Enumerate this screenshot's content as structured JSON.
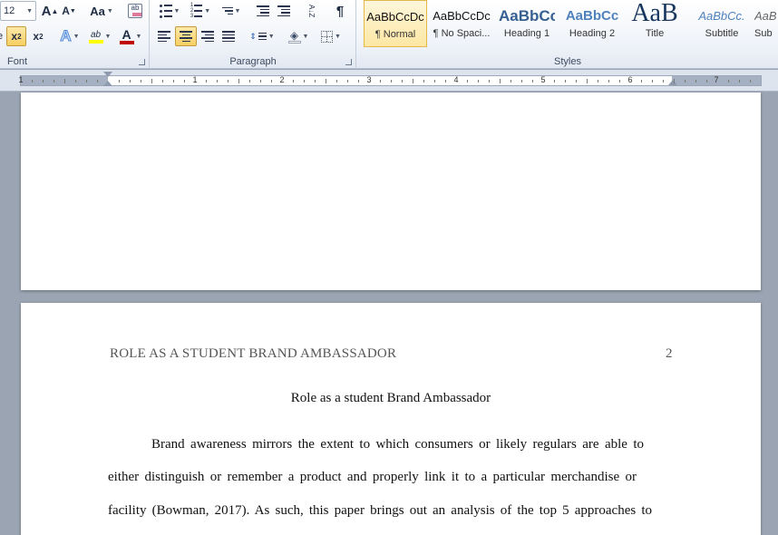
{
  "ribbon": {
    "font": {
      "label": "Font",
      "size_value": "12",
      "grow_label": "A",
      "shrink_label": "A",
      "change_case_label": "Aa",
      "subscript_label": "x",
      "superscript_label": "x",
      "text_effects_label": "A",
      "highlight_label": "ab",
      "font_color_label": "A",
      "font_color": "#c00000",
      "highlight_color": "#ffff00"
    },
    "paragraph": {
      "label": "Paragraph",
      "pilcrow": "¶",
      "sort_label": "A↓Z",
      "align_active": "center"
    },
    "styles": {
      "label": "Styles",
      "items": [
        {
          "sample": "AaBbCcDc",
          "name": "¶ Normal",
          "selected": true
        },
        {
          "sample": "AaBbCcDc",
          "name": "¶ No Spaci..."
        },
        {
          "sample": "AaBbCc",
          "name": "Heading 1"
        },
        {
          "sample": "AaBbCc",
          "name": "Heading 2"
        },
        {
          "sample": "AaB",
          "name": "Title"
        },
        {
          "sample": "AaBbCc.",
          "name": "Subtitle"
        },
        {
          "sample": "AaB",
          "name": "Sub"
        }
      ]
    }
  },
  "ruler": {
    "numbers": [
      "1",
      "1",
      "2",
      "3",
      "4",
      "5",
      "6",
      "7"
    ]
  },
  "document": {
    "running_head": "ROLE AS A STUDENT BRAND AMBASSADOR",
    "page_number": "2",
    "title": "Role as a student Brand Ambassador",
    "paragraph_lines": [
      "Brand awareness mirrors the extent to which consumers or likely regulars are able to",
      "either distinguish or remember a product and properly link it to a particular merchandise or",
      "facility (Bowman, 2017). As such, this paper brings out an analysis of the top 5 approaches to"
    ]
  }
}
